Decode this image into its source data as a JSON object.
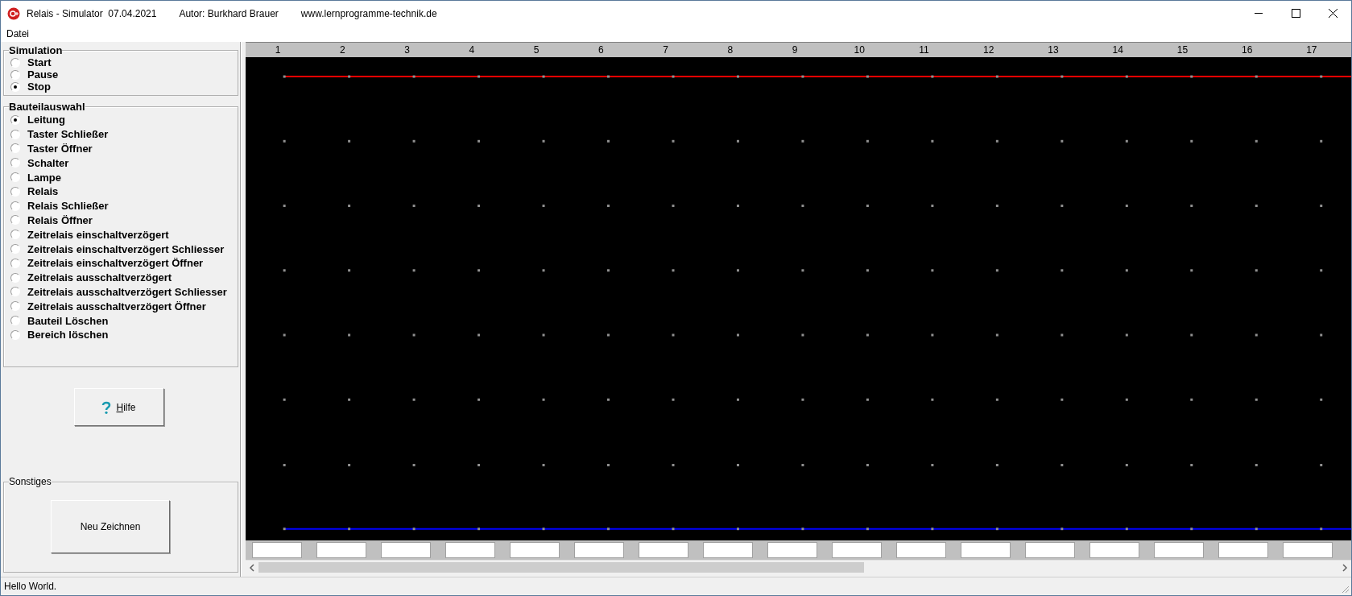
{
  "window": {
    "title": "Relais - Simulator  07.04.2021",
    "author": "Autor: Burkhard Brauer",
    "website": "www.lernprogramme-technik.de"
  },
  "menu": [
    "Datei"
  ],
  "simulation": {
    "title": "Simulation",
    "options": [
      {
        "label": "Start",
        "selected": false
      },
      {
        "label": "Pause",
        "selected": false
      },
      {
        "label": "Stop",
        "selected": true
      }
    ]
  },
  "components": {
    "title": "Bauteilauswahl",
    "options": [
      {
        "label": "Leitung",
        "selected": true
      },
      {
        "label": "Taster Schließer",
        "selected": false
      },
      {
        "label": "Taster Öffner",
        "selected": false
      },
      {
        "label": "Schalter",
        "selected": false
      },
      {
        "label": "Lampe",
        "selected": false
      },
      {
        "label": "Relais",
        "selected": false
      },
      {
        "label": "Relais Schließer",
        "selected": false
      },
      {
        "label": "Relais Öffner",
        "selected": false
      },
      {
        "label": "Zeitrelais einschaltverzögert",
        "selected": false
      },
      {
        "label": "Zeitrelais einschaltverzögert Schliesser",
        "selected": false
      },
      {
        "label": "Zeitrelais einschaltverzögert Öffner",
        "selected": false
      },
      {
        "label": "Zeitrelais ausschaltverzögert",
        "selected": false
      },
      {
        "label": "Zeitrelais ausschaltverzögert Schliesser",
        "selected": false
      },
      {
        "label": "Zeitrelais ausschaltverzögert Öffner",
        "selected": false
      },
      {
        "label": "Bauteil Löschen",
        "selected": false
      },
      {
        "label": "Bereich löschen",
        "selected": false
      }
    ]
  },
  "help_button": {
    "label": "Hilfe",
    "underline_first": true
  },
  "other": {
    "title": "Sonstiges",
    "button": "Neu Zeichnen"
  },
  "canvas": {
    "columns": [
      "1",
      "2",
      "3",
      "4",
      "5",
      "6",
      "7",
      "8",
      "9",
      "10",
      "11",
      "12",
      "13",
      "14",
      "15",
      "16",
      "17"
    ]
  },
  "status_bar": "Hello World."
}
